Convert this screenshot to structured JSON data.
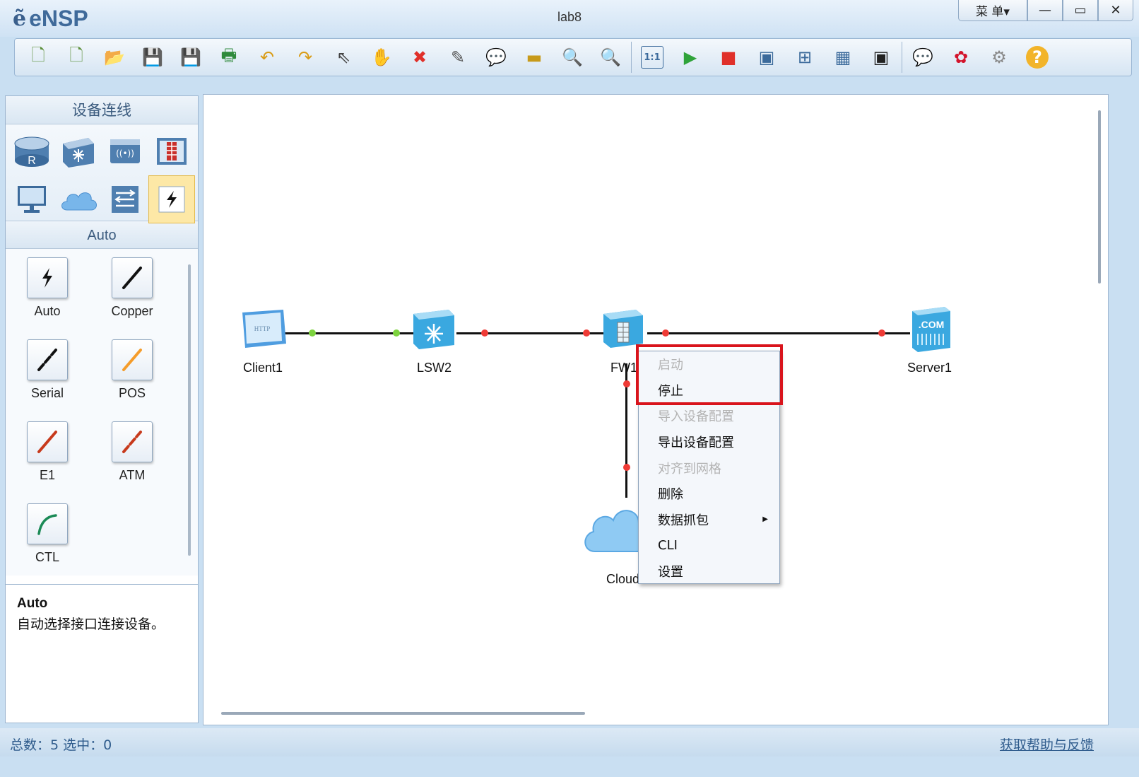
{
  "window": {
    "app_name": "eNSP",
    "title": "lab8",
    "menu_label": "菜 单▾",
    "minimize": "—",
    "maximize": "▭",
    "close": "✕"
  },
  "toolbar": {
    "buttons": [
      {
        "name": "new-topology-icon",
        "glyph": "🗋"
      },
      {
        "name": "new-example-icon",
        "glyph": "🗋"
      },
      {
        "name": "open-icon",
        "glyph": "📂"
      },
      {
        "name": "save-icon",
        "glyph": "💾"
      },
      {
        "name": "save-as-icon",
        "glyph": "💾"
      },
      {
        "name": "print-icon",
        "glyph": "🖶"
      },
      {
        "name": "undo-icon",
        "glyph": "↶"
      },
      {
        "name": "redo-icon",
        "glyph": "↷"
      },
      {
        "name": "select-icon",
        "glyph": "⇖"
      },
      {
        "name": "hand-icon",
        "glyph": "✋"
      },
      {
        "name": "delete-icon",
        "glyph": "✖"
      },
      {
        "name": "delete-link-icon",
        "glyph": "✎"
      },
      {
        "name": "text-icon",
        "glyph": "💬"
      },
      {
        "name": "palette-icon",
        "glyph": "▬"
      },
      {
        "name": "zoom-in-icon",
        "glyph": "🔍"
      },
      {
        "name": "zoom-out-icon",
        "glyph": "🔍"
      },
      {
        "name": "fit-icon",
        "glyph": "1:1"
      },
      {
        "name": "start-icon",
        "glyph": "▶"
      },
      {
        "name": "stop-icon",
        "glyph": "■"
      },
      {
        "name": "capture-icon",
        "glyph": "▣"
      },
      {
        "name": "topology-icon",
        "glyph": "⊞"
      },
      {
        "name": "grid-icon",
        "glyph": "▦"
      },
      {
        "name": "screen-icon",
        "glyph": "▣"
      },
      {
        "name": "chat-icon",
        "glyph": "💬"
      },
      {
        "name": "huawei-icon",
        "glyph": "✿"
      },
      {
        "name": "settings-icon",
        "glyph": "⚙"
      },
      {
        "name": "help-icon",
        "glyph": "?"
      }
    ]
  },
  "left_panel": {
    "title": "设备连线",
    "devices": [
      {
        "name": "router-icon"
      },
      {
        "name": "switch-icon"
      },
      {
        "name": "wlan-icon"
      },
      {
        "name": "firewall-icon"
      },
      {
        "name": "pc-icon"
      },
      {
        "name": "cloud-icon"
      },
      {
        "name": "other-device-icon"
      },
      {
        "name": "cable-icon",
        "selected": true
      }
    ],
    "section_title": "Auto",
    "cables": [
      {
        "label": "Auto",
        "color": "#111111",
        "type": "bolt"
      },
      {
        "label": "Copper",
        "color": "#111111",
        "type": "line"
      },
      {
        "label": "Serial",
        "color": "#111111",
        "type": "dashed"
      },
      {
        "label": "POS",
        "color": "#f59c2a",
        "type": "line"
      },
      {
        "label": "E1",
        "color": "#c73a1c",
        "type": "line"
      },
      {
        "label": "ATM",
        "color": "#c73a1c",
        "type": "dashed"
      },
      {
        "label": "CTL",
        "color": "#1b8a56",
        "type": "curve"
      }
    ],
    "desc_title": "Auto",
    "desc_text": "自动选择接口连接设备。"
  },
  "topology": {
    "nodes": [
      {
        "id": "client1",
        "label": "Client1"
      },
      {
        "id": "lsw2",
        "label": "LSW2"
      },
      {
        "id": "fw1",
        "label": "FW1"
      },
      {
        "id": "server1",
        "label": "Server1"
      },
      {
        "id": "cloud",
        "label": "Cloud"
      }
    ]
  },
  "context_menu": {
    "items": [
      {
        "label": "启动",
        "disabled": true
      },
      {
        "label": "停止",
        "disabled": false
      },
      {
        "label": "导入设备配置",
        "disabled": true
      },
      {
        "label": "导出设备配置",
        "disabled": false
      },
      {
        "label": "对齐到网格",
        "disabled": true
      },
      {
        "label": "删除",
        "disabled": false
      },
      {
        "label": "数据抓包",
        "disabled": false,
        "submenu": true
      },
      {
        "label": "CLI",
        "disabled": false
      },
      {
        "label": "设置",
        "disabled": false
      }
    ]
  },
  "status_bar": {
    "counts": "总数：5  选中：0",
    "help_link": "获取帮助与反馈"
  },
  "colors": {
    "link_up": "#7dd33f",
    "link_down": "#ef3b36",
    "highlight": "#d9141c"
  }
}
